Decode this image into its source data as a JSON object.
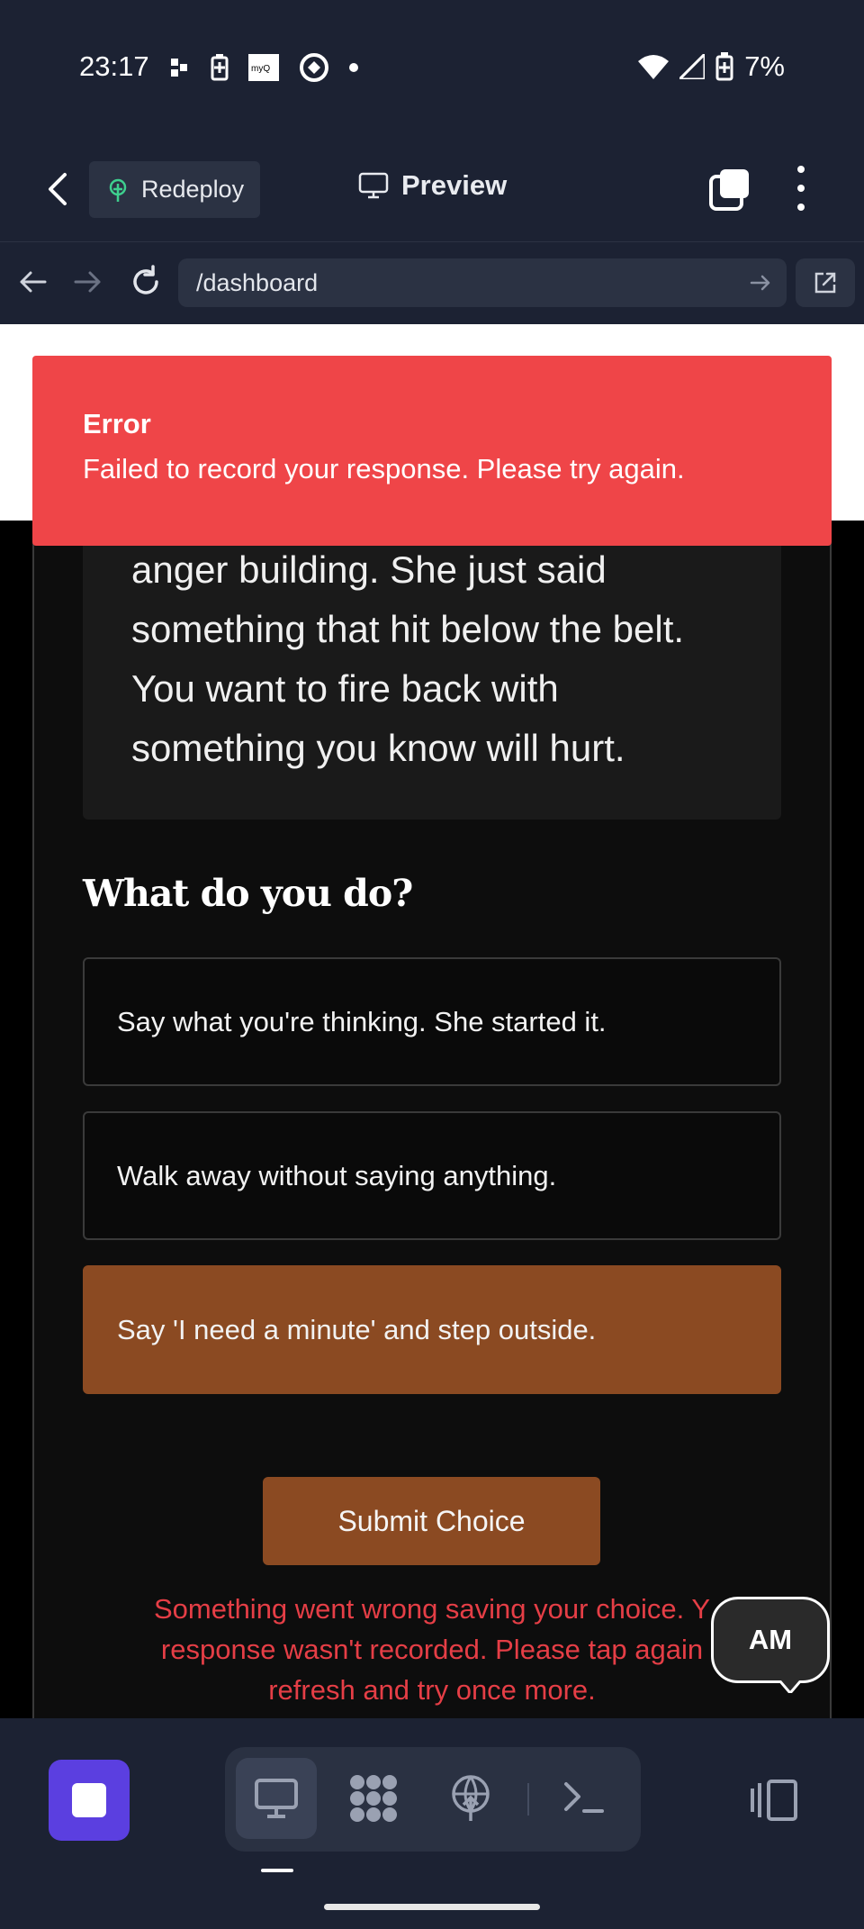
{
  "status_bar": {
    "time": "23:17",
    "battery": "7%",
    "icons": [
      "tailscale-icon",
      "battery-saver-icon",
      "myq-icon",
      "claude-icon",
      "dot-icon",
      "wifi-icon",
      "signal-icon",
      "battery-icon"
    ]
  },
  "app_header": {
    "redeploy_label": "Redeploy",
    "preview_label": "Preview"
  },
  "url_bar": {
    "path": "/dashboard"
  },
  "toast": {
    "title": "Error",
    "message": "Failed to record your response. Please try again."
  },
  "scenario": {
    "text": "anger building. She just said something that hit below the belt. You want to fire back with something you know will hurt."
  },
  "question": "What do you do?",
  "options": [
    {
      "label": "Say what you're thinking. She started it.",
      "selected": false
    },
    {
      "label": "Walk away without saying anything.",
      "selected": false
    },
    {
      "label": "Say 'I need a minute' and step outside.",
      "selected": true
    }
  ],
  "submit_label": "Submit Choice",
  "error_message": "Something went wrong saving your choice. Y... response wasn't recorded. Please tap again... refresh and try once more.",
  "error_lines": [
    "Something went wrong saving your choice. Y",
    "response wasn't recorded. Please tap again",
    "refresh and try once more."
  ],
  "avatar_initials": "AM",
  "colors": {
    "toast_bg": "#ef4548",
    "accent": "#8b4a22",
    "error_text": "#e53e46",
    "stop_button": "#5b3fe0"
  }
}
